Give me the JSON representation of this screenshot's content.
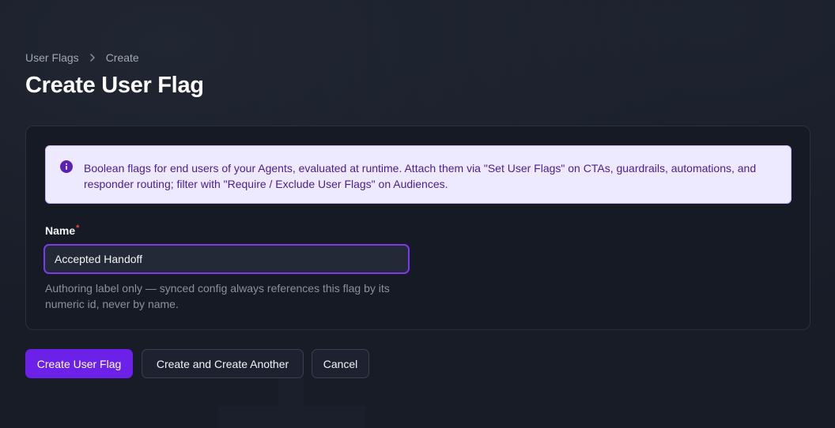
{
  "breadcrumb": {
    "parent": "User Flags",
    "current": "Create"
  },
  "page": {
    "title": "Create User Flag"
  },
  "info": {
    "icon": "info-circle-icon",
    "text": "Boolean flags for end users of your Agents, evaluated at runtime. Attach them via \"Set User Flags\" on CTAs, guardrails, automations, and responder routing; filter with \"Require / Exclude User Flags\" on Audiences."
  },
  "form": {
    "name_label": "Name",
    "required_marker": "*",
    "name_value": "Accepted Handoff",
    "name_helper": "Authoring label only — synced config always references this flag by its numeric id, never by name."
  },
  "actions": {
    "create_label": "Create User Flag",
    "create_another_label": "Create and Create Another",
    "cancel_label": "Cancel"
  },
  "colors": {
    "accent": "#6b21e8",
    "input_border": "#7c3aed",
    "info_bg": "#ede9fe",
    "info_text": "#4c1d95",
    "required": "#ef4444"
  }
}
